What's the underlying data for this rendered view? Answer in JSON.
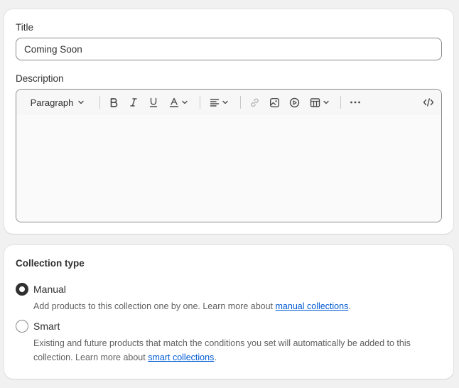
{
  "form": {
    "title_label": "Title",
    "title_value": "Coming Soon",
    "description_label": "Description"
  },
  "editor": {
    "paragraph_label": "Paragraph",
    "icons": [
      "chevron-down-icon",
      "bold-icon",
      "italic-icon",
      "underline-icon",
      "text-color-icon",
      "align-icon",
      "link-icon",
      "image-icon",
      "video-icon",
      "table-icon",
      "more-icon",
      "code-view-icon"
    ]
  },
  "collection_type": {
    "title": "Collection type",
    "manual": {
      "label": "Manual",
      "help_prefix": "Add products to this collection one by one. Learn more about ",
      "help_link": "manual collections",
      "help_suffix": "."
    },
    "smart": {
      "label": "Smart",
      "help_prefix": "Existing and future products that match the conditions you set will automatically be added to this collection. Learn more about ",
      "help_link": "smart collections",
      "help_suffix": "."
    }
  },
  "colors": {
    "link": "#005bd3",
    "border": "#8a8a8a",
    "text": "#303030"
  }
}
